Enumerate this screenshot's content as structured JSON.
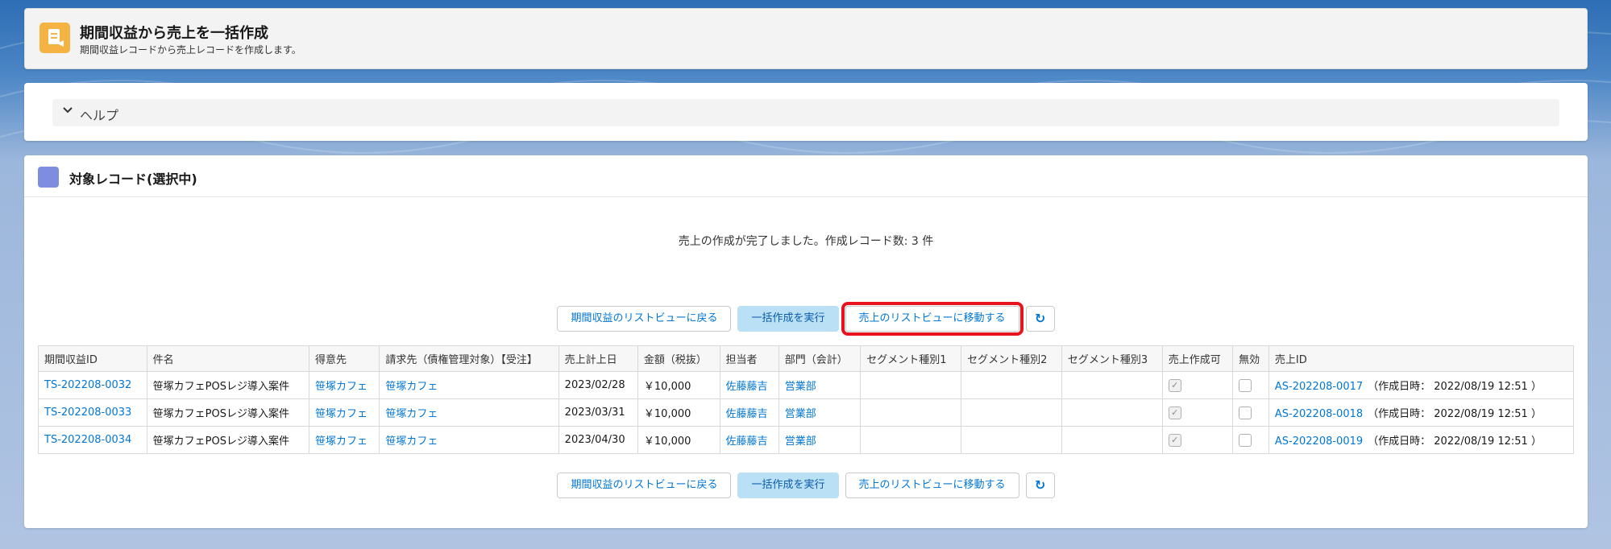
{
  "header": {
    "title": "期間収益から売上を一括作成",
    "subtitle": "期間収益レコードから売上レコードを作成します。"
  },
  "help": {
    "label": "ヘルプ"
  },
  "records": {
    "title": "対象レコード(選択中)",
    "message": "売上の作成が完了しました。作成レコード数: 3 件"
  },
  "buttons": {
    "back": "期間収益のリストビューに戻る",
    "execute": "一括作成を実行",
    "goto": "売上のリストビューに移動する",
    "refresh": "↻"
  },
  "table": {
    "headers": [
      "期間収益ID",
      "件名",
      "得意先",
      "請求先（債権管理対象）【受注】",
      "売上計上日",
      "金額（税抜）",
      "担当者",
      "部門（会計）",
      "セグメント種別1",
      "セグメント種別2",
      "セグメント種別3",
      "売上作成可",
      "無効",
      "売上ID"
    ],
    "rows": [
      {
        "id": "TS-202208-0032",
        "name": "笹塚カフェPOSレジ導入案件",
        "customer": "笹塚カフェ",
        "bill": "笹塚カフェ",
        "date": "2023/02/28",
        "amount": "￥10,000",
        "owner": "佐藤藤吉",
        "dept": "営業部",
        "s1": "",
        "s2": "",
        "s3": "",
        "can": "✓",
        "inv": "",
        "sales": "AS-202208-0017",
        "created": "（作成日時： 2022/08/19 12:51 ）"
      },
      {
        "id": "TS-202208-0033",
        "name": "笹塚カフェPOSレジ導入案件",
        "customer": "笹塚カフェ",
        "bill": "笹塚カフェ",
        "date": "2023/03/31",
        "amount": "￥10,000",
        "owner": "佐藤藤吉",
        "dept": "営業部",
        "s1": "",
        "s2": "",
        "s3": "",
        "can": "✓",
        "inv": "",
        "sales": "AS-202208-0018",
        "created": "（作成日時： 2022/08/19 12:51 ）"
      },
      {
        "id": "TS-202208-0034",
        "name": "笹塚カフェPOSレジ導入案件",
        "customer": "笹塚カフェ",
        "bill": "笹塚カフェ",
        "date": "2023/04/30",
        "amount": "￥10,000",
        "owner": "佐藤藤吉",
        "dept": "営業部",
        "s1": "",
        "s2": "",
        "s3": "",
        "can": "✓",
        "inv": "",
        "sales": "AS-202208-0019",
        "created": "（作成日時： 2022/08/19 12:51 ）"
      }
    ]
  },
  "colors": {
    "accent": "#0176d3",
    "highlight": "#e8131f",
    "header_icon": "#f5b344",
    "section_icon": "#7f8de1"
  }
}
